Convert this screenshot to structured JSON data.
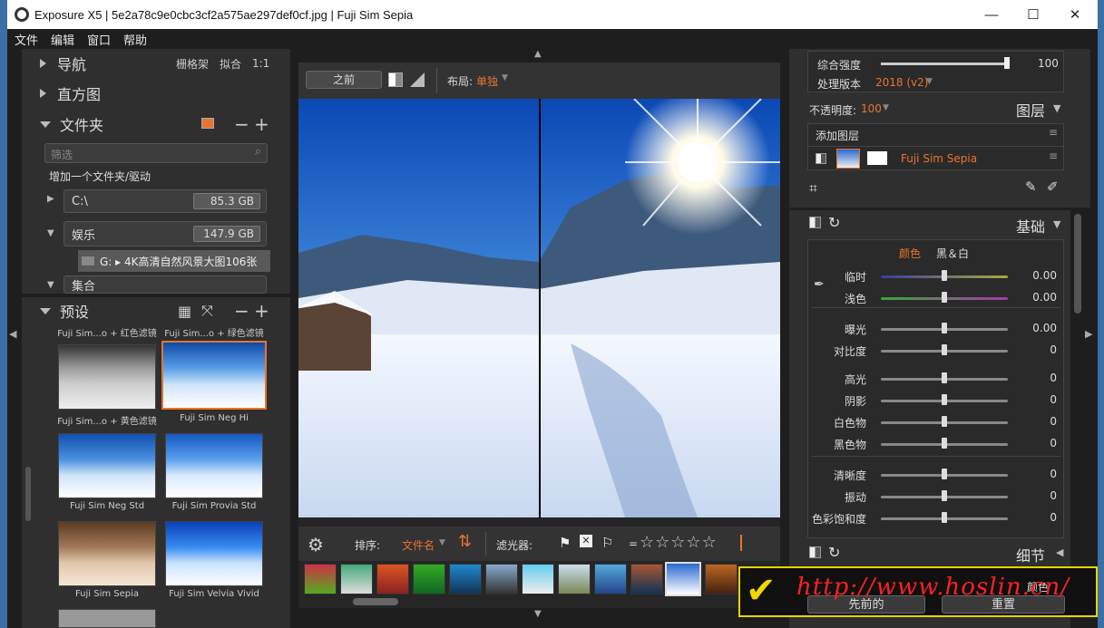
{
  "titlebar": {
    "title": "Exposure X5 | 5e2a78c9e0cbc3cf2a575ae297def0cf.jpg | Fuji Sim Sepia",
    "minimize": "—",
    "maximize": "☐",
    "close": "✕"
  },
  "menu": [
    "文件",
    "编辑",
    "窗口",
    "帮助"
  ],
  "left": {
    "nav_title": "导航",
    "nav_opts": [
      "栅格架",
      "拟合",
      "1:1"
    ],
    "histogram_title": "直方图",
    "folders_title": "文件夹",
    "filter_placeholder": "筛选",
    "add_folder": "增加一个文件夹/驱动",
    "drives": [
      {
        "name": "C:\\",
        "size": "85.3 GB"
      },
      {
        "name": "娱乐",
        "size": "147.9 GB"
      }
    ],
    "subfolder": "G: ▸ 4K高清自然风景大图106张",
    "collection": "集合",
    "presets_title": "预设",
    "presets_top": [
      "Fuji Sim...o + 红色滤镜",
      "Fuji Sim...o + 绿色滤镜"
    ],
    "presets": [
      {
        "label": "Fuji Sim...o + 黄色滤镜"
      },
      {
        "label": "Fuji Sim Neg Hi"
      },
      {
        "label": "Fuji Sim Neg Std"
      },
      {
        "label": "Fuji Sim Provia Std"
      },
      {
        "label": "Fuji Sim Sepia"
      },
      {
        "label": "Fuji Sim Velvia Vivid"
      }
    ]
  },
  "center": {
    "before_btn": "之前",
    "layout_label": "布局:",
    "layout_value": "单独",
    "sort_label": "排序:",
    "sort_value": "文件名",
    "filter_label": "滤光器:",
    "rating_prefix": "=",
    "stars": "☆☆☆☆☆"
  },
  "right": {
    "overall_label": "综合强度",
    "overall_value": "100",
    "overall_fraction": 1.0,
    "version_label": "处理版本",
    "version_value": "2018 (v2)",
    "opacity_label": "不透明度:",
    "opacity_value": "100",
    "layers_title": "图层",
    "add_layer": "添加图层",
    "layer_name": "Fuji Sim Sepia",
    "basic_title": "基础",
    "color_tab": "颜色",
    "bw_tab": "黑＆白",
    "sliders": [
      {
        "label": "临时",
        "value": "0.00",
        "fraction": 0.5
      },
      {
        "label": "浅色",
        "value": "0.00",
        "fraction": 0.5
      },
      {
        "label": "曝光",
        "value": "0.00",
        "fraction": 0.5
      },
      {
        "label": "对比度",
        "value": "0",
        "fraction": 0.5
      },
      {
        "label": "高光",
        "value": "0",
        "fraction": 0.5
      },
      {
        "label": "阴影",
        "value": "0",
        "fraction": 0.5
      },
      {
        "label": "白色物",
        "value": "0",
        "fraction": 0.5
      },
      {
        "label": "黑色物",
        "value": "0",
        "fraction": 0.5
      },
      {
        "label": "清晰度",
        "value": "0",
        "fraction": 0.5
      },
      {
        "label": "振动",
        "value": "0",
        "fraction": 0.5
      },
      {
        "label": "色彩饱和度",
        "value": "0",
        "fraction": 0.5
      }
    ],
    "detail_title": "细节",
    "color_title": "颜色",
    "prev_btn": "先前的",
    "reset_btn": "重置"
  },
  "watermark": "http://www.hoslin.cn/",
  "colors": {
    "accent": "#e8742e",
    "panel": "#2f2f2f",
    "bg": "#1e1e1e"
  }
}
